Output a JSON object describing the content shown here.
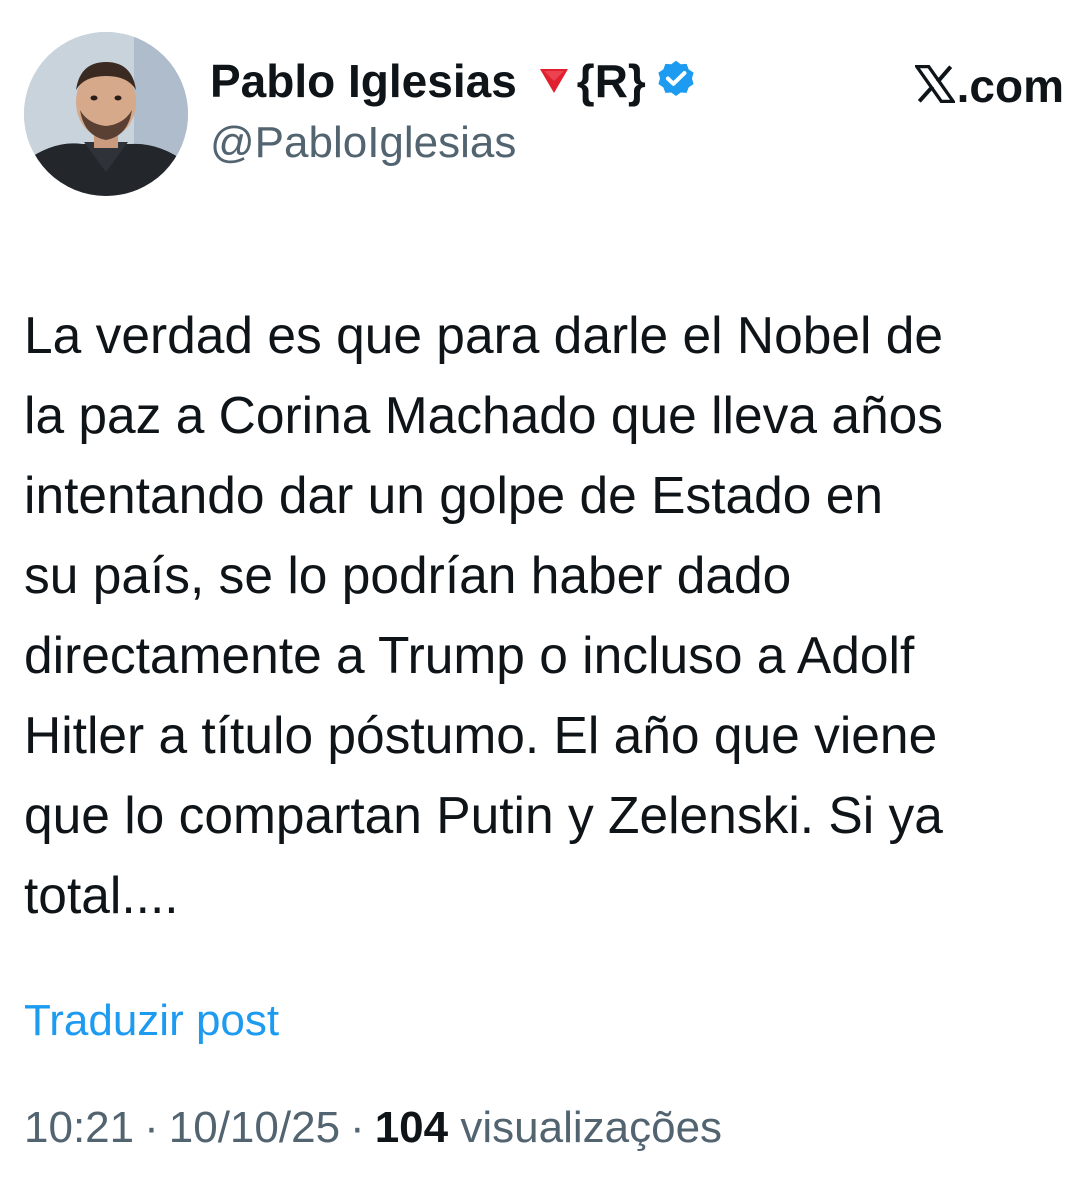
{
  "author": {
    "display_name": "Pablo Iglesias",
    "name_suffix": "{R}",
    "handle": "@PabloIglesias",
    "icons": [
      "red-triangle-icon",
      "verified-badge-icon"
    ],
    "verified_color": "#1d9bf0"
  },
  "site": {
    "label": ".com",
    "logo_icon": "x-logo-icon"
  },
  "tweet": {
    "lines": [
      "La verdad es que para darle el Nobel de",
      "la paz a Corina Machado que lleva años",
      "intentando dar un golpe de Estado en",
      "su país, se lo podrían haber dado",
      "directamente a Trump o incluso a Adolf",
      "Hitler a título póstumo. El año que viene",
      "que lo compartan Putin y Zelenski. Si ya",
      "total...."
    ]
  },
  "translate": {
    "label": "Traduzir post"
  },
  "meta": {
    "time": "10:21",
    "separator": "·",
    "date": "10/10/25",
    "views_count": "104",
    "views_label": "visualizações"
  },
  "colors": {
    "text": "#0f1419",
    "secondary": "#536471",
    "link": "#1d9bf0",
    "triangle": "#e0202e"
  }
}
